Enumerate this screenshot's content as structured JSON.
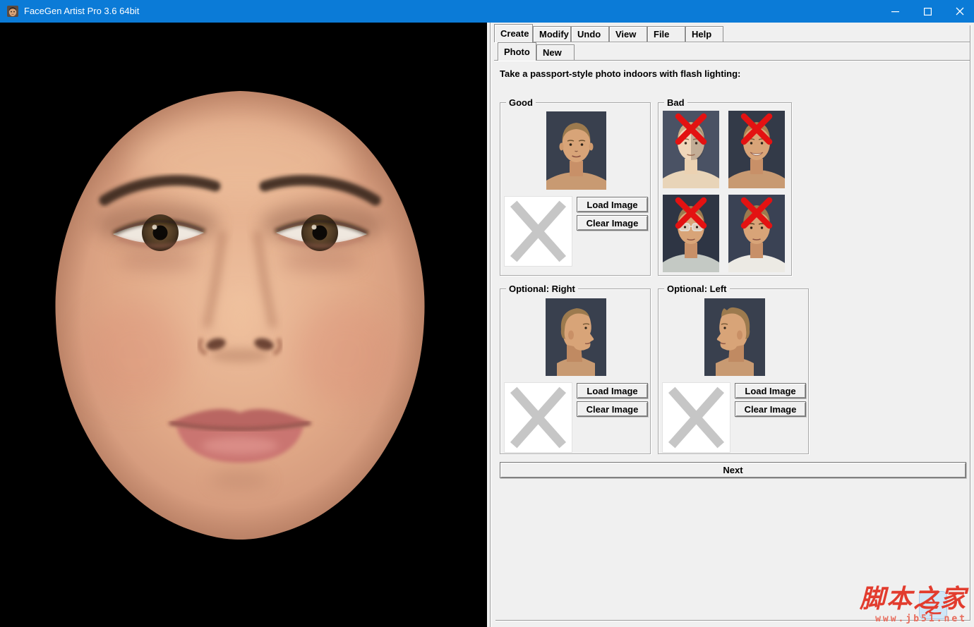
{
  "window": {
    "title": "FaceGen Artist Pro 3.6 64bit"
  },
  "icons": {
    "titlebar_app": "face-thumbnail",
    "minimize": "horizontal-bar",
    "maximize": "hollow-square",
    "close": "x-cross",
    "bad_overlay": "red-x",
    "empty_slot": "gray-x"
  },
  "colors": {
    "titlebar": "#0b7bd7",
    "panel": "#f0f0f0",
    "viewport": "#000000",
    "bad_x": "#e31212",
    "placeholder_x": "#c6c6c6",
    "watermark_red": "#e23c2e"
  },
  "tabs": {
    "main": [
      {
        "label": "Create",
        "active": true
      },
      {
        "label": "Modify",
        "active": false
      },
      {
        "label": "Undo",
        "active": false
      },
      {
        "label": "View",
        "active": false
      },
      {
        "label": "File",
        "active": false
      },
      {
        "label": "Help",
        "active": false
      }
    ],
    "sub": [
      {
        "label": "Photo",
        "active": true
      },
      {
        "label": "New",
        "active": false
      }
    ]
  },
  "photo_tab": {
    "instruction": "Take a passport-style photo indoors with flash lighting:",
    "good": {
      "title": "Good",
      "load_label": "Load Image",
      "clear_label": "Clear Image"
    },
    "bad": {
      "title": "Bad"
    },
    "optional_right": {
      "title": "Optional: Right",
      "load_label": "Load Image",
      "clear_label": "Clear Image"
    },
    "optional_left": {
      "title": "Optional: Left",
      "load_label": "Load Image",
      "clear_label": "Clear Image"
    },
    "next_label": "Next"
  },
  "watermark": {
    "site_name": "脚本之家",
    "site_url": "www.jb51.net",
    "logo_glyph": "之"
  }
}
